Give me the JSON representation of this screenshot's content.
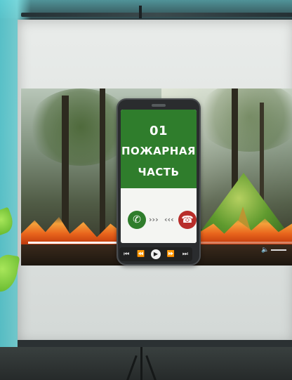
{
  "phone_screen": {
    "line1": "01",
    "line2": "ПОЖАРНАЯ",
    "line3": "ЧАСТЬ"
  },
  "call_buttons": {
    "accept_icon": "phone-accept-icon",
    "decline_icon": "phone-decline-icon",
    "swipe_right": "›››",
    "swipe_left": "‹‹‹"
  },
  "player": {
    "progress": 0.55,
    "icons": [
      "skip-back-icon",
      "rewind-icon",
      "play-icon",
      "fast-forward-icon",
      "skip-forward-icon"
    ]
  },
  "colors": {
    "call_green": "#2f7d2c",
    "decline_red": "#b82d2a",
    "frame_cyan": "#7ee2e6"
  }
}
